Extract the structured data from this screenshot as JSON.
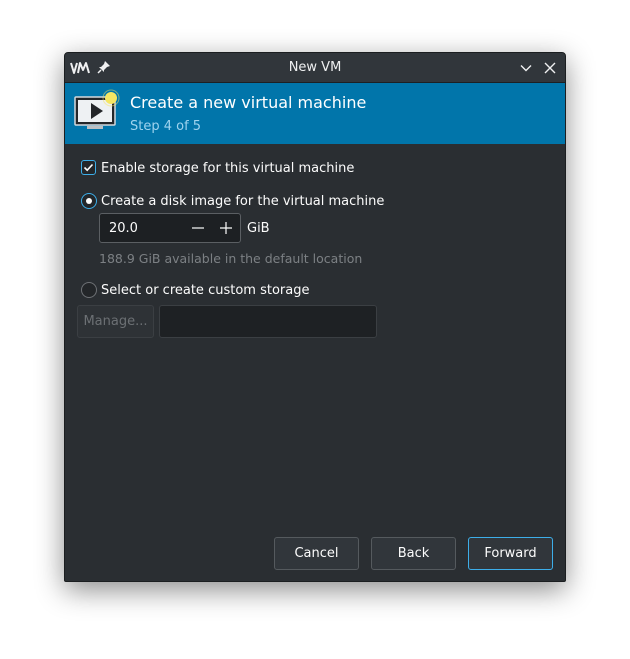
{
  "window": {
    "title": "New VM"
  },
  "header": {
    "title": "Create a new virtual machine",
    "step": "Step 4 of 5"
  },
  "storage": {
    "enable_label": "Enable storage for this virtual machine",
    "enable_checked": true,
    "disk_image_label": "Create a disk image for the virtual machine",
    "disk_image_selected": true,
    "size_value": "20.0",
    "size_unit": "GiB",
    "available_hint": "188.9 GiB available in the default location",
    "custom_label": "Select or create custom storage",
    "custom_selected": false,
    "manage_label": "Manage...",
    "path_value": ""
  },
  "buttons": {
    "cancel": "Cancel",
    "back": "Back",
    "forward": "Forward"
  },
  "colors": {
    "header_bg": "#0175aa",
    "accent": "#3daee9",
    "window_bg": "#2a2e32"
  },
  "icons": {
    "logo": "virt-manager-logo-icon",
    "pin": "pin-icon",
    "minimize": "chevron-down-icon",
    "close": "close-icon",
    "header": "new-vm-icon"
  }
}
